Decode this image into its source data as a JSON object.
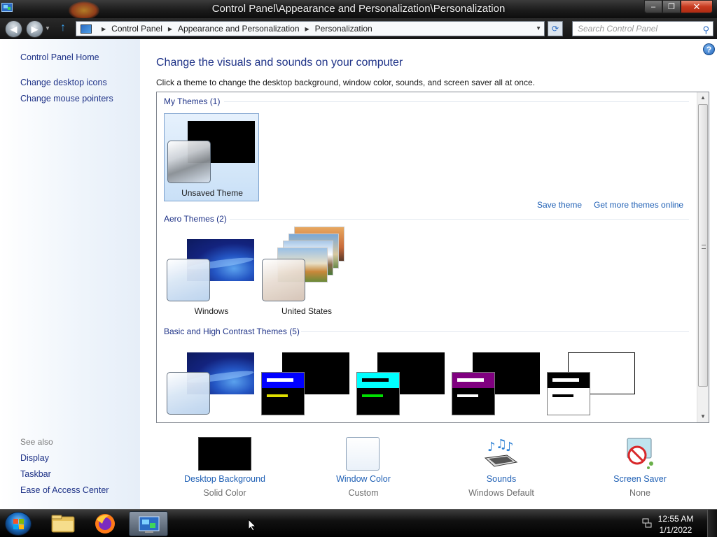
{
  "window": {
    "title": "Control Panel\\Appearance and Personalization\\Personalization",
    "caption": {
      "minimize": "–",
      "maximize": "❐",
      "close": "✕"
    }
  },
  "address": {
    "breadcrumbs": [
      "Control Panel",
      "Appearance and Personalization",
      "Personalization"
    ],
    "search_placeholder": "Search Control Panel"
  },
  "left_pane": {
    "links": [
      "Control Panel Home",
      "Change desktop icons",
      "Change mouse pointers"
    ],
    "see_also_label": "See also",
    "see_also": [
      "Display",
      "Taskbar",
      "Ease of Access Center"
    ]
  },
  "main": {
    "title": "Change the visuals and sounds on your computer",
    "subtitle": "Click a theme to change the desktop background, window color, sounds, and screen saver all at once.",
    "groups": {
      "my_themes": "My Themes (1)",
      "aero_themes": "Aero Themes (2)",
      "basic_themes": "Basic and High Contrast Themes (5)"
    },
    "themes": {
      "unsaved": "Unsaved Theme",
      "windows": "Windows",
      "united_states": "United States"
    },
    "links": {
      "save_theme": "Save theme",
      "get_more": "Get more themes online"
    },
    "help": "?"
  },
  "settings": [
    {
      "name": "Desktop Background",
      "value": "Solid Color"
    },
    {
      "name": "Window Color",
      "value": "Custom"
    },
    {
      "name": "Sounds",
      "value": "Windows Default"
    },
    {
      "name": "Screen Saver",
      "value": "None"
    }
  ],
  "taskbar": {
    "time": "12:55 AM",
    "date": "1/1/2022"
  },
  "colors": {
    "link": "#1e3287",
    "setting_link": "#1e5fb4",
    "hc1": "#0000ff",
    "hc2": "#00ffff",
    "hc3": "#800080"
  }
}
